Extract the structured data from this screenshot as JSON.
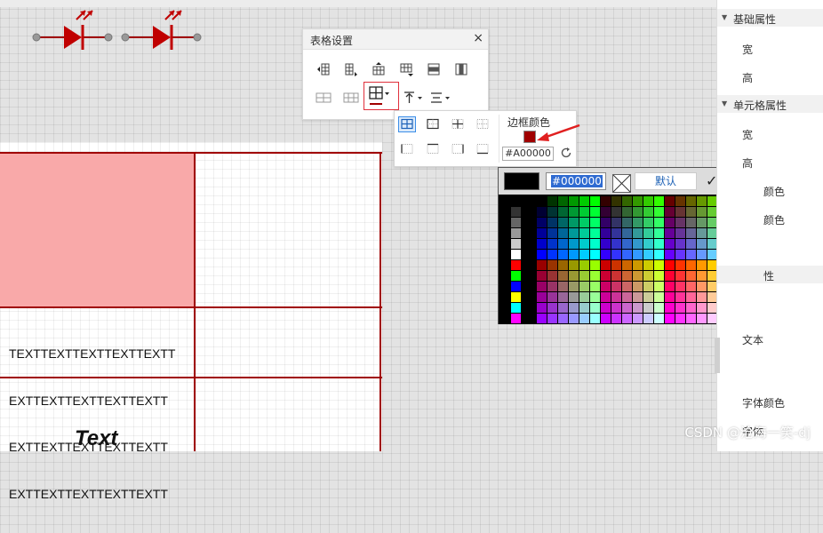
{
  "dialog": {
    "title": "表格设置",
    "close": "×"
  },
  "border_popup": {
    "title": "边框颜色",
    "color_value": "#A00000",
    "border_color": "#a00000"
  },
  "color_picker": {
    "input_value": "#000000",
    "default_label": "默认",
    "ok_icon": "✓",
    "close_icon": "×",
    "preview_color": "#000000"
  },
  "table": {
    "text_cell_lines": [
      "TEXTTEXTTEXTTEXTTEXTT",
      "EXTTEXTTEXTTEXTTEXTT",
      "EXTTEXTTEXTTEXTTEXTT",
      "EXTTEXTTEXTTEXTTEXTT"
    ],
    "italic_text": "Text",
    "fill_color": "#f9a9a9"
  },
  "right_panel": {
    "sections": [
      {
        "label": "基础属性",
        "items": [
          "宽",
          "高"
        ]
      },
      {
        "label": "单元格属性",
        "items": [
          "宽",
          "高",
          "颜色",
          "颜色"
        ]
      },
      {
        "label": "性",
        "items": [
          "文本",
          "字体颜色",
          "字体"
        ]
      }
    ]
  },
  "watermark": "CSDN @沧海一笑-dj"
}
